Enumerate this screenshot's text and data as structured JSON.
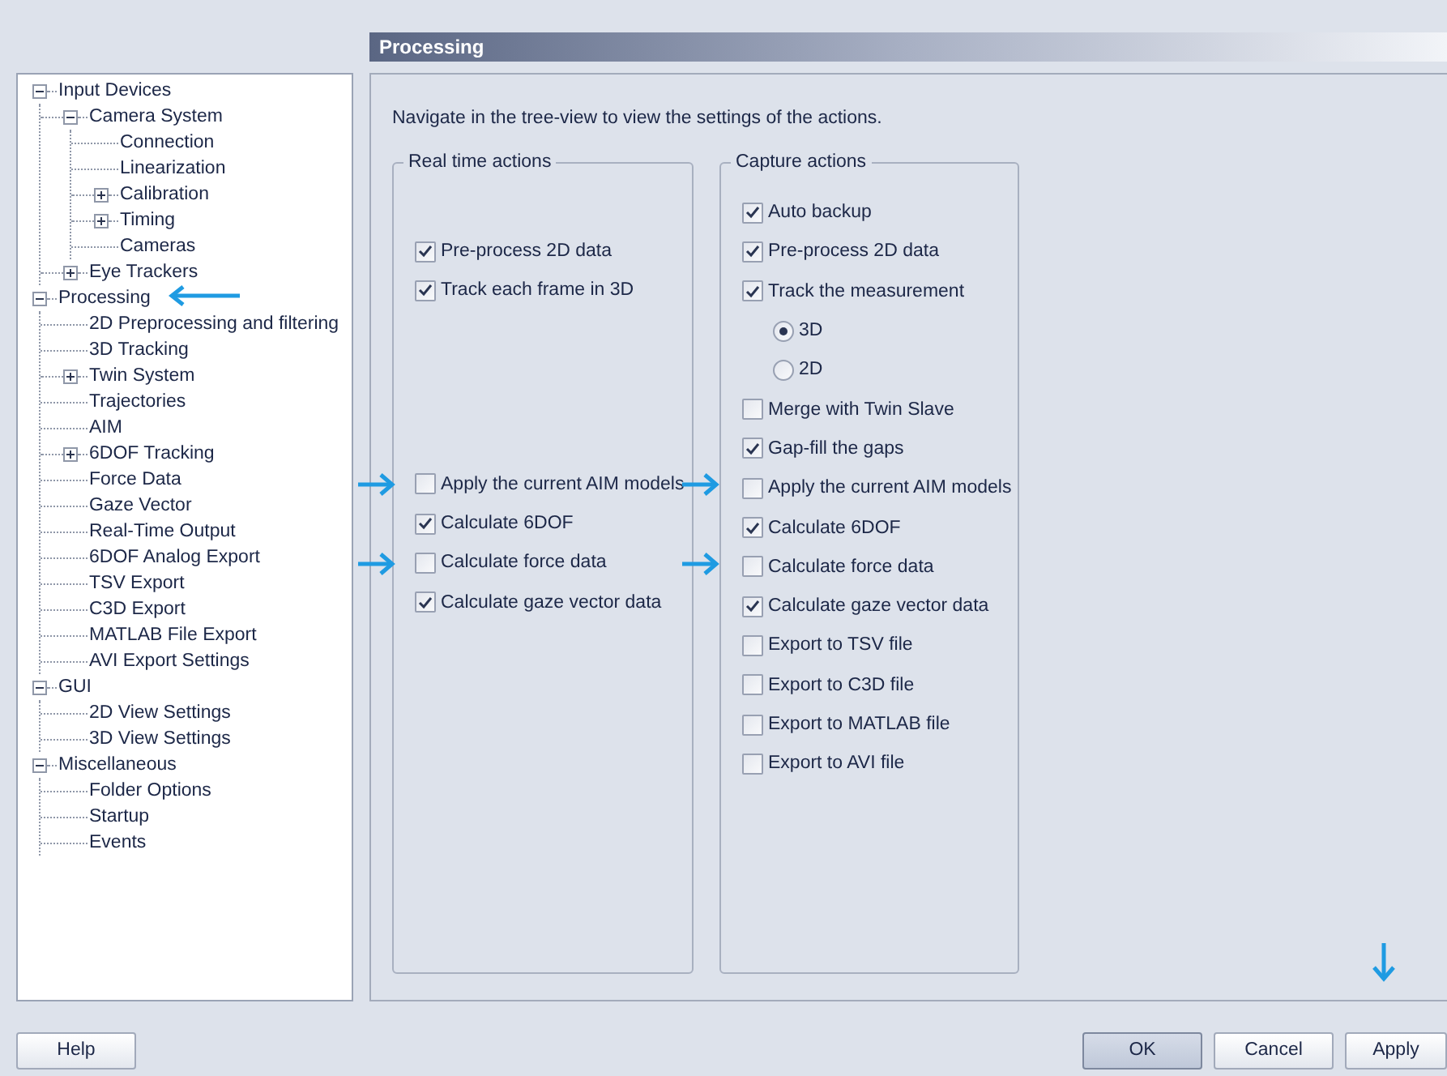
{
  "tree": [
    {
      "label": "Input Devices",
      "kind": "folder",
      "expanded": true,
      "children": [
        {
          "label": "Camera System",
          "kind": "folder",
          "expanded": true,
          "children": [
            {
              "label": "Connection",
              "kind": "leaf"
            },
            {
              "label": "Linearization",
              "kind": "leaf"
            },
            {
              "label": "Calibration",
              "kind": "folder",
              "expanded": false
            },
            {
              "label": "Timing",
              "kind": "folder",
              "expanded": false
            },
            {
              "label": "Cameras",
              "kind": "leaf"
            }
          ]
        },
        {
          "label": "Eye Trackers",
          "kind": "folder",
          "expanded": false
        }
      ]
    },
    {
      "label": "Processing",
      "kind": "folder",
      "expanded": true,
      "children": [
        {
          "label": "2D Preprocessing and filtering",
          "kind": "leaf"
        },
        {
          "label": "3D Tracking",
          "kind": "leaf"
        },
        {
          "label": "Twin System",
          "kind": "folder",
          "expanded": false
        },
        {
          "label": "Trajectories",
          "kind": "leaf"
        },
        {
          "label": "AIM",
          "kind": "leaf"
        },
        {
          "label": "6DOF Tracking",
          "kind": "folder",
          "expanded": false
        },
        {
          "label": "Force Data",
          "kind": "leaf"
        },
        {
          "label": "Gaze Vector",
          "kind": "leaf"
        },
        {
          "label": "Real-Time Output",
          "kind": "leaf"
        },
        {
          "label": "6DOF Analog Export",
          "kind": "leaf"
        },
        {
          "label": "TSV Export",
          "kind": "leaf"
        },
        {
          "label": "C3D Export",
          "kind": "leaf"
        },
        {
          "label": "MATLAB File Export",
          "kind": "leaf"
        },
        {
          "label": "AVI Export Settings",
          "kind": "leaf"
        }
      ]
    },
    {
      "label": "GUI",
      "kind": "folder",
      "expanded": true,
      "children": [
        {
          "label": "2D View Settings",
          "kind": "leaf"
        },
        {
          "label": "3D View Settings",
          "kind": "leaf"
        }
      ]
    },
    {
      "label": "Miscellaneous",
      "kind": "folder",
      "expanded": true,
      "children": [
        {
          "label": "Folder Options",
          "kind": "leaf"
        },
        {
          "label": "Startup",
          "kind": "leaf"
        },
        {
          "label": "Events",
          "kind": "leaf"
        }
      ]
    }
  ],
  "panel": {
    "title": "Processing",
    "description": "Navigate in the tree-view to view the settings of the actions.",
    "groups": [
      {
        "title": "Real time actions",
        "items": [
          {
            "kind": "checkbox",
            "label": "Pre-process 2D data",
            "checked": true
          },
          {
            "kind": "checkbox",
            "label": "Track each frame in 3D",
            "checked": true
          },
          {
            "kind": "checkbox",
            "label": "Apply the current AIM models",
            "checked": false
          },
          {
            "kind": "checkbox",
            "label": "Calculate 6DOF",
            "checked": true
          },
          {
            "kind": "checkbox",
            "label": "Calculate force data",
            "checked": false
          },
          {
            "kind": "checkbox",
            "label": "Calculate gaze vector data",
            "checked": true
          }
        ]
      },
      {
        "title": "Capture actions",
        "items": [
          {
            "kind": "checkbox",
            "label": "Auto backup",
            "checked": true
          },
          {
            "kind": "checkbox",
            "label": "Pre-process 2D data",
            "checked": true
          },
          {
            "kind": "checkbox",
            "label": "Track the measurement",
            "checked": true
          },
          {
            "kind": "radio",
            "label": "3D",
            "selected": true
          },
          {
            "kind": "radio",
            "label": "2D",
            "selected": false
          },
          {
            "kind": "checkbox",
            "label": "Merge with Twin Slave",
            "checked": false
          },
          {
            "kind": "checkbox",
            "label": "Gap-fill the gaps",
            "checked": true
          },
          {
            "kind": "checkbox",
            "label": "Apply the current AIM models",
            "checked": false
          },
          {
            "kind": "checkbox",
            "label": "Calculate 6DOF",
            "checked": true
          },
          {
            "kind": "checkbox",
            "label": "Calculate force data",
            "checked": false
          },
          {
            "kind": "checkbox",
            "label": "Calculate gaze vector data",
            "checked": true
          },
          {
            "kind": "checkbox",
            "label": "Export to TSV file",
            "checked": false
          },
          {
            "kind": "checkbox",
            "label": "Export to C3D file",
            "checked": false
          },
          {
            "kind": "checkbox",
            "label": "Export to MATLAB file",
            "checked": false
          },
          {
            "kind": "checkbox",
            "label": "Export to AVI file",
            "checked": false
          }
        ]
      }
    ]
  },
  "buttons_left": [
    {
      "label": "Help",
      "default": false
    }
  ],
  "buttons_right": [
    {
      "label": "OK",
      "default": true
    },
    {
      "label": "Cancel",
      "default": false
    },
    {
      "label": "Apply",
      "default": false
    }
  ]
}
